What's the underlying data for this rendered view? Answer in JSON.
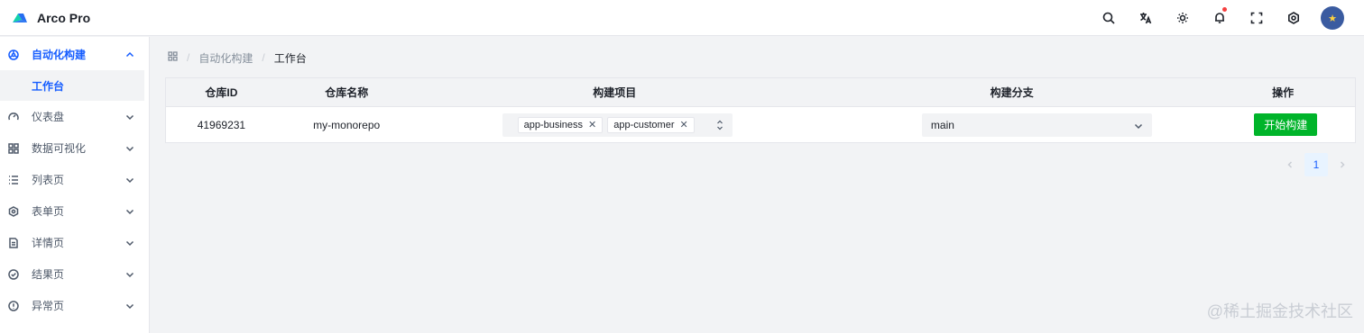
{
  "app": {
    "title": "Arco Pro",
    "brand_color": "#165dff"
  },
  "header": {
    "icons": [
      "search-icon",
      "translate-icon",
      "theme-icon",
      "bell-icon",
      "fullscreen-icon",
      "settings-icon"
    ],
    "notification_dot_color": "#f53f3f"
  },
  "sidebar": {
    "items": [
      {
        "label": "自动化构建",
        "icon": "build-icon",
        "expanded": true
      },
      {
        "label": "仪表盘",
        "icon": "dashboard-icon"
      },
      {
        "label": "数据可视化",
        "icon": "grid-icon"
      },
      {
        "label": "列表页",
        "icon": "list-icon"
      },
      {
        "label": "表单页",
        "icon": "form-icon"
      },
      {
        "label": "详情页",
        "icon": "detail-icon"
      },
      {
        "label": "结果页",
        "icon": "check-circle-icon"
      },
      {
        "label": "异常页",
        "icon": "exclamation-icon"
      }
    ],
    "submenu": {
      "label": "工作台"
    }
  },
  "breadcrumb": {
    "parent": "自动化构建",
    "current": "工作台"
  },
  "table": {
    "headers": [
      "仓库ID",
      "仓库名称",
      "构建项目",
      "构建分支",
      "操作"
    ],
    "row": {
      "repo_id": "41969231",
      "repo_name": "my-monorepo",
      "projects": [
        "app-business",
        "app-customer"
      ],
      "branch": "main",
      "action_label": "开始构建"
    }
  },
  "pagination": {
    "current": "1"
  },
  "watermark": "@稀土掘金技术社区"
}
